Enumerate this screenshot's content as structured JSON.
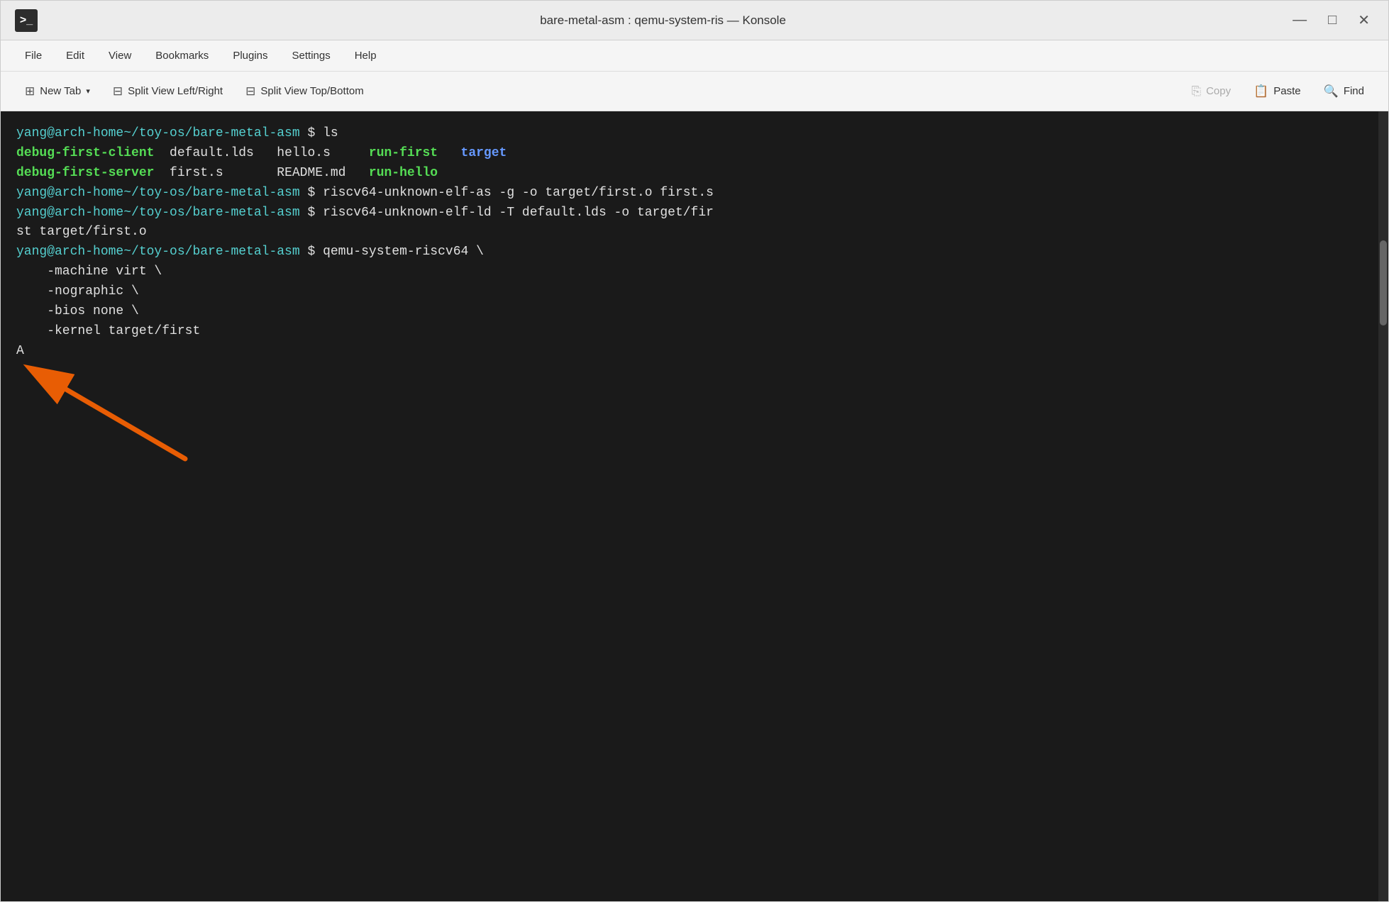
{
  "titlebar": {
    "icon": ">_",
    "title": "bare-metal-asm : qemu-system-ris — Konsole",
    "minimize_label": "—",
    "maximize_label": "□",
    "close_label": "✕"
  },
  "menubar": {
    "items": [
      {
        "label": "File",
        "id": "file"
      },
      {
        "label": "Edit",
        "id": "edit"
      },
      {
        "label": "View",
        "id": "view"
      },
      {
        "label": "Bookmarks",
        "id": "bookmarks"
      },
      {
        "label": "Plugins",
        "id": "plugins"
      },
      {
        "label": "Settings",
        "id": "settings"
      },
      {
        "label": "Help",
        "id": "help"
      }
    ]
  },
  "toolbar": {
    "new_tab_label": "New Tab",
    "split_lr_label": "Split View Left/Right",
    "split_tb_label": "Split View Top/Bottom",
    "copy_label": "Copy",
    "paste_label": "Paste",
    "find_label": "Find"
  },
  "terminal": {
    "lines": [
      {
        "type": "prompt_cmd",
        "prompt": "yang@arch-home~/toy-os/bare-metal-asm",
        "cmd": " $ ls"
      },
      {
        "type": "ls_output_1",
        "col1": "debug-first-client",
        "col1_class": "green-bold",
        "col2": "default.lds",
        "col3": "hello.s",
        "col4": "run-first",
        "col4_class": "green-bold",
        "col5": "target",
        "col5_class": "blue-bold"
      },
      {
        "type": "ls_output_2",
        "col1": "debug-first-server",
        "col1_class": "green-bold",
        "col2": "first.s",
        "col3": "README.md",
        "col4": "run-hello",
        "col4_class": "green-bold"
      },
      {
        "type": "prompt_cmd",
        "prompt": "yang@arch-home~/toy-os/bare-metal-asm",
        "cmd": " $ riscv64-unknown-elf-as -g -o target/first.o first.s"
      },
      {
        "type": "prompt_cmd",
        "prompt": "yang@arch-home~/toy-os/bare-metal-asm",
        "cmd": " $ riscv64-unknown-elf-ld -T default.lds -o target/fir"
      },
      {
        "type": "continuation",
        "text": "st target/first.o"
      },
      {
        "type": "prompt_cmd",
        "prompt": "yang@arch-home~/toy-os/bare-metal-asm",
        "cmd": " $ qemu-system-riscv64 \\"
      },
      {
        "type": "continuation",
        "text": "    -machine virt \\"
      },
      {
        "type": "continuation",
        "text": "    -nographic \\"
      },
      {
        "type": "continuation",
        "text": "    -bios none \\"
      },
      {
        "type": "continuation",
        "text": "    -kernel target/first"
      },
      {
        "type": "output",
        "text": "A"
      }
    ]
  }
}
